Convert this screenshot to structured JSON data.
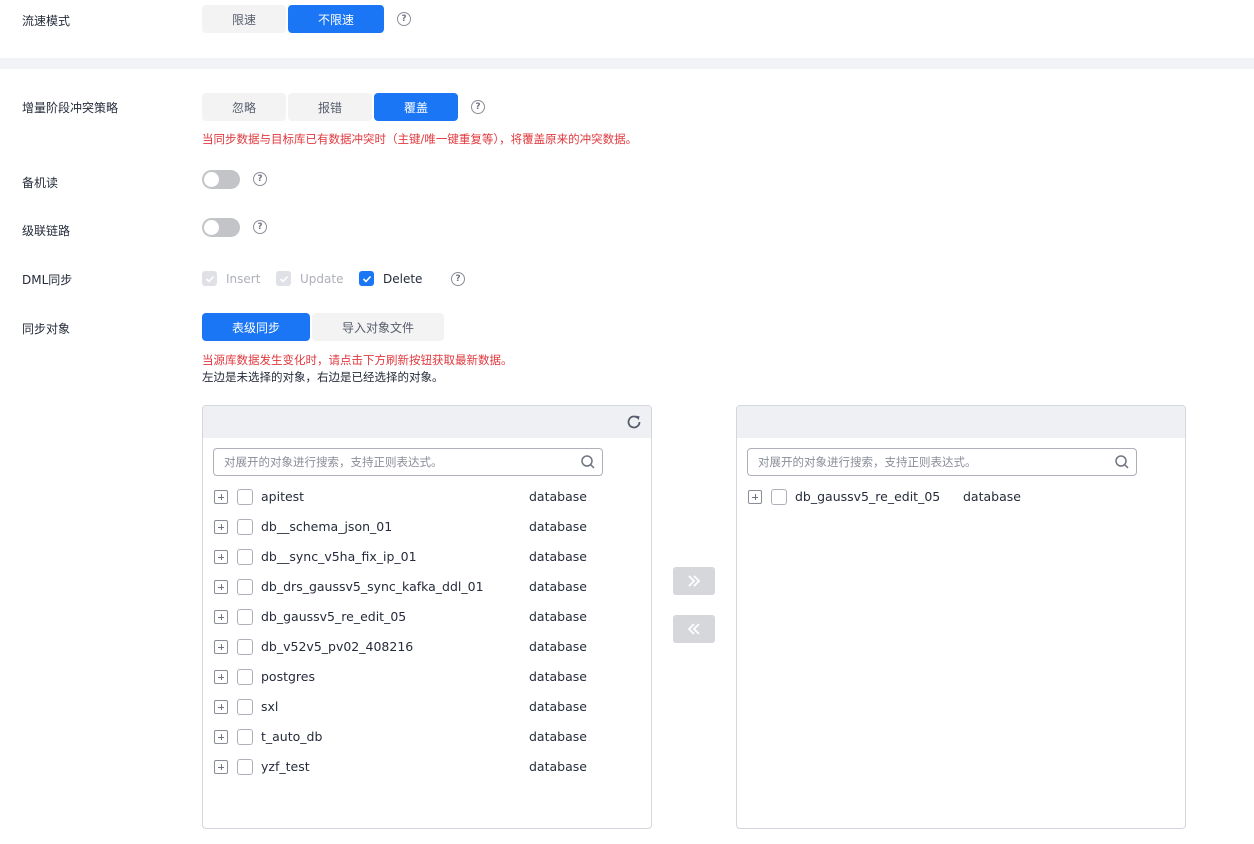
{
  "flow_mode": {
    "label": "流速模式",
    "options": [
      "限速",
      "不限速"
    ],
    "selected": "不限速"
  },
  "conflict_policy": {
    "label": "增量阶段冲突策略",
    "options": [
      "忽略",
      "报错",
      "覆盖"
    ],
    "selected": "覆盖",
    "warning": "当同步数据与目标库已有数据冲突时（主键/唯一键重复等），将覆盖原来的冲突数据。"
  },
  "standby_read": {
    "label": "备机读",
    "enabled": false
  },
  "cascade_link": {
    "label": "级联链路",
    "enabled": false
  },
  "dml_sync": {
    "label": "DML同步",
    "options": [
      {
        "label": "Insert",
        "checked": true,
        "disabled": true
      },
      {
        "label": "Update",
        "checked": true,
        "disabled": true
      },
      {
        "label": "Delete",
        "checked": true,
        "disabled": false
      }
    ]
  },
  "sync_objects": {
    "label": "同步对象",
    "tabs": [
      "表级同步",
      "导入对象文件"
    ],
    "selected_tab": "表级同步",
    "warning": "当源库数据发生变化时，请点击下方刷新按钮获取最新数据。",
    "note": "左边是未选择的对象，右边是已经选择的对象。"
  },
  "left_panel": {
    "search_placeholder": "对展开的对象进行搜索，支持正则表达式。",
    "items": [
      {
        "name": "apitest",
        "type": "database"
      },
      {
        "name": "db__schema_json_01",
        "type": "database"
      },
      {
        "name": "db__sync_v5ha_fix_ip_01",
        "type": "database"
      },
      {
        "name": "db_drs_gaussv5_sync_kafka_ddl_01",
        "type": "database"
      },
      {
        "name": "db_gaussv5_re_edit_05",
        "type": "database"
      },
      {
        "name": "db_v52v5_pv02_408216",
        "type": "database"
      },
      {
        "name": "postgres",
        "type": "database"
      },
      {
        "name": "sxl",
        "type": "database"
      },
      {
        "name": "t_auto_db",
        "type": "database"
      },
      {
        "name": "yzf_test",
        "type": "database"
      }
    ]
  },
  "right_panel": {
    "search_placeholder": "对展开的对象进行搜索，支持正则表达式。",
    "items": [
      {
        "name": "db_gaussv5_re_edit_05",
        "type": "database"
      }
    ]
  },
  "colors": {
    "primary": "#1a76f5",
    "warning": "#e0383e",
    "disabled": "#d5d7db"
  }
}
